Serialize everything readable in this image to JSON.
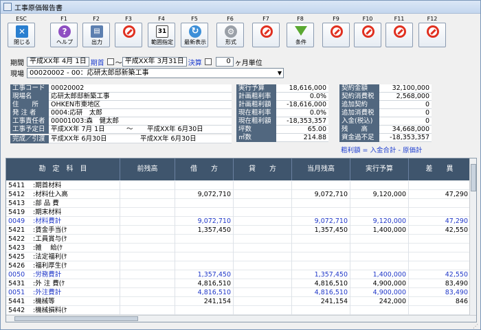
{
  "window": {
    "title": "工事原価報告書"
  },
  "fkeys": [
    {
      "key": "ESC",
      "label": "閉じる",
      "icon": "close-icon"
    },
    {
      "key": "F1",
      "label": "ヘルプ",
      "icon": "help-icon"
    },
    {
      "key": "F2",
      "label": "出力",
      "icon": "output-icon"
    },
    {
      "key": "F3",
      "label": "",
      "icon": "disabled-icon"
    },
    {
      "key": "F4",
      "label": "範囲指定",
      "icon": "calendar-icon"
    },
    {
      "key": "F5",
      "label": "最新表示",
      "icon": "refresh-icon"
    },
    {
      "key": "F6",
      "label": "形式",
      "icon": "gear-icon"
    },
    {
      "key": "F7",
      "label": "",
      "icon": "disabled-icon"
    },
    {
      "key": "F8",
      "label": "条件",
      "icon": "filter-icon"
    },
    {
      "key": "F9",
      "label": "",
      "icon": "disabled-icon"
    },
    {
      "key": "F10",
      "label": "",
      "icon": "disabled-icon"
    },
    {
      "key": "F11",
      "label": "",
      "icon": "disabled-icon"
    },
    {
      "key": "F12",
      "label": "",
      "icon": "disabled-icon"
    }
  ],
  "period": {
    "label": "期間",
    "from": "平成XX年 4月 1日",
    "link1": "期首",
    "sep": "〜",
    "to": "平成XX年 3月31日",
    "link2": "決算",
    "unit_value": "0",
    "unit_label": "ヶ月単位"
  },
  "site": {
    "label": "現場",
    "value": "00020002 - 00：応研太郎邸新築工事"
  },
  "info": {
    "rows": [
      {
        "k": "工事コード",
        "v": "00020002"
      },
      {
        "k": "現場名",
        "v": "応研太郎邸新築工事"
      },
      {
        "k": "住　　所",
        "v": "OHKEN市東地区"
      },
      {
        "k": "発 注 者",
        "v": "0004:応研　太郎"
      },
      {
        "k": "工事責任者",
        "v": "00001003:森　健太郎"
      }
    ],
    "schedule_label": "工事予定日",
    "schedule_from": "平成XX年 7月 1日",
    "schedule_sep": "〜",
    "schedule_to": "平成XX年 6月30日",
    "complete_label": "完成／引渡",
    "complete_from": "平成XX年 6月30日",
    "complete_to": "平成XX年 6月30日"
  },
  "budget": [
    {
      "k": "実行予算",
      "v": "18,616,000"
    },
    {
      "k": "計画粗利率",
      "v": "0.0%"
    },
    {
      "k": "計画粗利額",
      "v": "-18,616,000"
    },
    {
      "k": "現在粗利率",
      "v": "0.0%"
    },
    {
      "k": "現在粗利額",
      "v": "-18,353,357"
    },
    {
      "k": "坪数",
      "v": "65.00"
    },
    {
      "k": "㎡数",
      "v": "214.88"
    }
  ],
  "contract": [
    {
      "k": "契約金額",
      "v": "32,100,000"
    },
    {
      "k": "契約消費税",
      "v": "2,568,000"
    },
    {
      "k": "追加契約",
      "v": "0"
    },
    {
      "k": "追加消費税",
      "v": "0"
    },
    {
      "k": "入金(税込)",
      "v": "0"
    },
    {
      "k": "残　　高",
      "v": "34,668,000"
    },
    {
      "k": "資金過不足",
      "v": "-18,353,357"
    }
  ],
  "note": "粗利額 = 入金合計 - 原価計",
  "grid": {
    "headers": [
      "勘　定　科　目",
      "前残高",
      "借　　方",
      "貸　　方",
      "当月残高",
      "実行予算",
      "差　　異"
    ],
    "rows": [
      {
        "code": "5411",
        "name": ":期首材料",
        "prev": "",
        "debit": "",
        "credit": "",
        "bal": "",
        "budget": "",
        "diff": "",
        "blue": false
      },
      {
        "code": "5412",
        "name": ":材料仕入高",
        "prev": "",
        "debit": "9,072,710",
        "credit": "",
        "bal": "9,072,710",
        "budget": "9,120,000",
        "diff": "47,290",
        "blue": false
      },
      {
        "code": "5413",
        "name": ":部 品 費",
        "prev": "",
        "debit": "",
        "credit": "",
        "bal": "",
        "budget": "",
        "diff": "",
        "blue": false
      },
      {
        "code": "5419",
        "name": ":期末材料",
        "prev": "",
        "debit": "",
        "credit": "",
        "bal": "",
        "budget": "",
        "diff": "",
        "blue": false
      },
      {
        "code": "0049",
        "name": ":材料費計",
        "prev": "",
        "debit": "9,072,710",
        "credit": "",
        "bal": "9,072,710",
        "budget": "9,120,000",
        "diff": "47,290",
        "blue": true
      },
      {
        "code": "5421",
        "name": ":賃金手当(ｹ",
        "prev": "",
        "debit": "1,357,450",
        "credit": "",
        "bal": "1,357,450",
        "budget": "1,400,000",
        "diff": "42,550",
        "blue": false
      },
      {
        "code": "5422",
        "name": ":工員賞与(ｹ",
        "prev": "",
        "debit": "",
        "credit": "",
        "bal": "",
        "budget": "",
        "diff": "",
        "blue": false
      },
      {
        "code": "5423",
        "name": ":雑　 給(ｹ",
        "prev": "",
        "debit": "",
        "credit": "",
        "bal": "",
        "budget": "",
        "diff": "",
        "blue": false
      },
      {
        "code": "5425",
        "name": ":法定福利(ｹ",
        "prev": "",
        "debit": "",
        "credit": "",
        "bal": "",
        "budget": "",
        "diff": "",
        "blue": false
      },
      {
        "code": "5426",
        "name": ":福利厚生(ｹ",
        "prev": "",
        "debit": "",
        "credit": "",
        "bal": "",
        "budget": "",
        "diff": "",
        "blue": false
      },
      {
        "code": "0050",
        "name": ":労務費計",
        "prev": "",
        "debit": "1,357,450",
        "credit": "",
        "bal": "1,357,450",
        "budget": "1,400,000",
        "diff": "42,550",
        "blue": true
      },
      {
        "code": "5431",
        "name": ":外 注 費(ｹ",
        "prev": "",
        "debit": "4,816,510",
        "credit": "",
        "bal": "4,816,510",
        "budget": "4,900,000",
        "diff": "83,490",
        "blue": false
      },
      {
        "code": "0051",
        "name": ":外注費計",
        "prev": "",
        "debit": "4,816,510",
        "credit": "",
        "bal": "4,816,510",
        "budget": "4,900,000",
        "diff": "83,490",
        "blue": true
      },
      {
        "code": "5441",
        "name": ":機械等",
        "prev": "",
        "debit": "241,154",
        "credit": "",
        "bal": "241,154",
        "budget": "242,000",
        "diff": "846",
        "blue": false
      },
      {
        "code": "5442",
        "name": ":機械損料(ｹ",
        "prev": "",
        "debit": "",
        "credit": "",
        "bal": "",
        "budget": "",
        "diff": "",
        "blue": false
      }
    ]
  }
}
